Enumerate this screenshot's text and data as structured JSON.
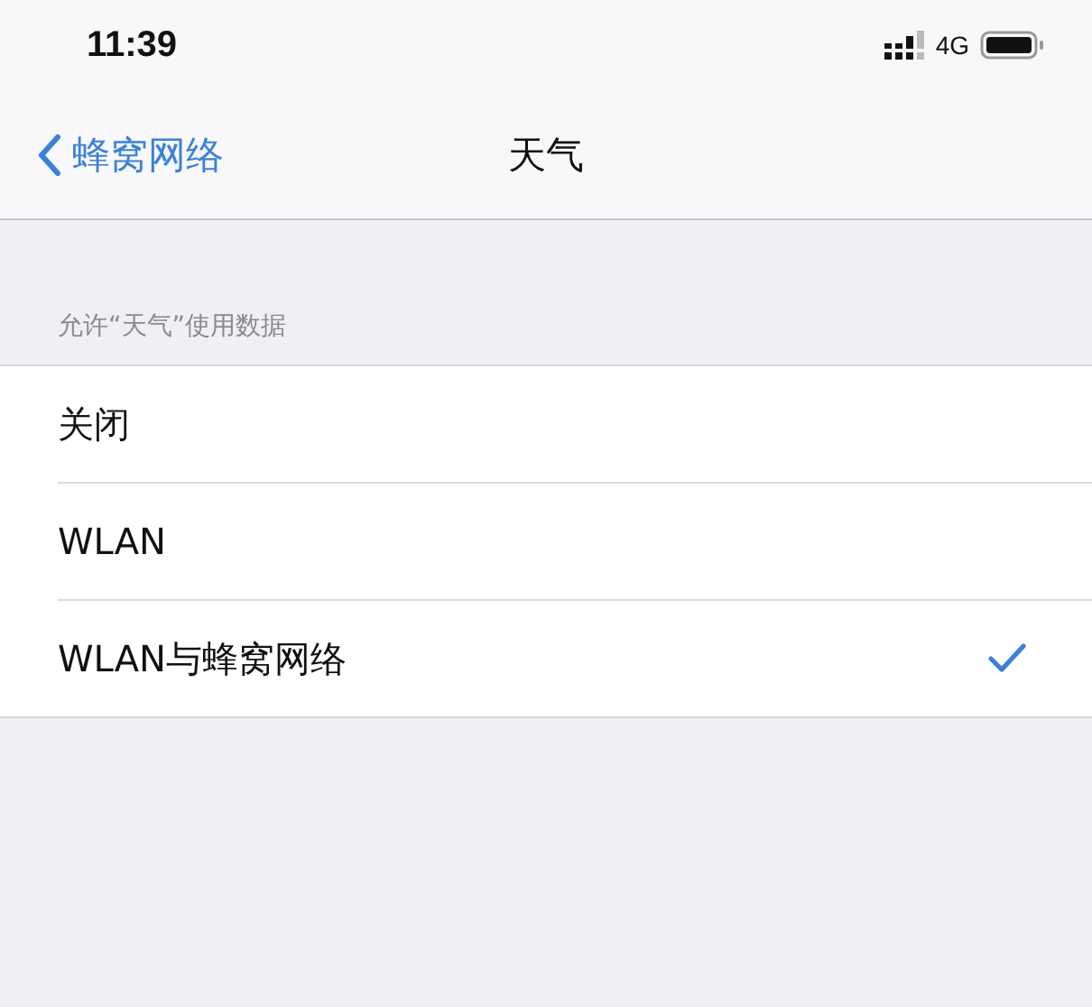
{
  "status_bar": {
    "time": "11:39",
    "network": "4G"
  },
  "nav_bar": {
    "back": "蜂窝网络",
    "title": "天气"
  },
  "section": {
    "header": "允许“天气”使用数据",
    "options": [
      {
        "label": "关闭",
        "selected": false
      },
      {
        "label": "WLAN",
        "selected": false
      },
      {
        "label": "WLAN与蜂窝网络",
        "selected": true
      }
    ]
  }
}
